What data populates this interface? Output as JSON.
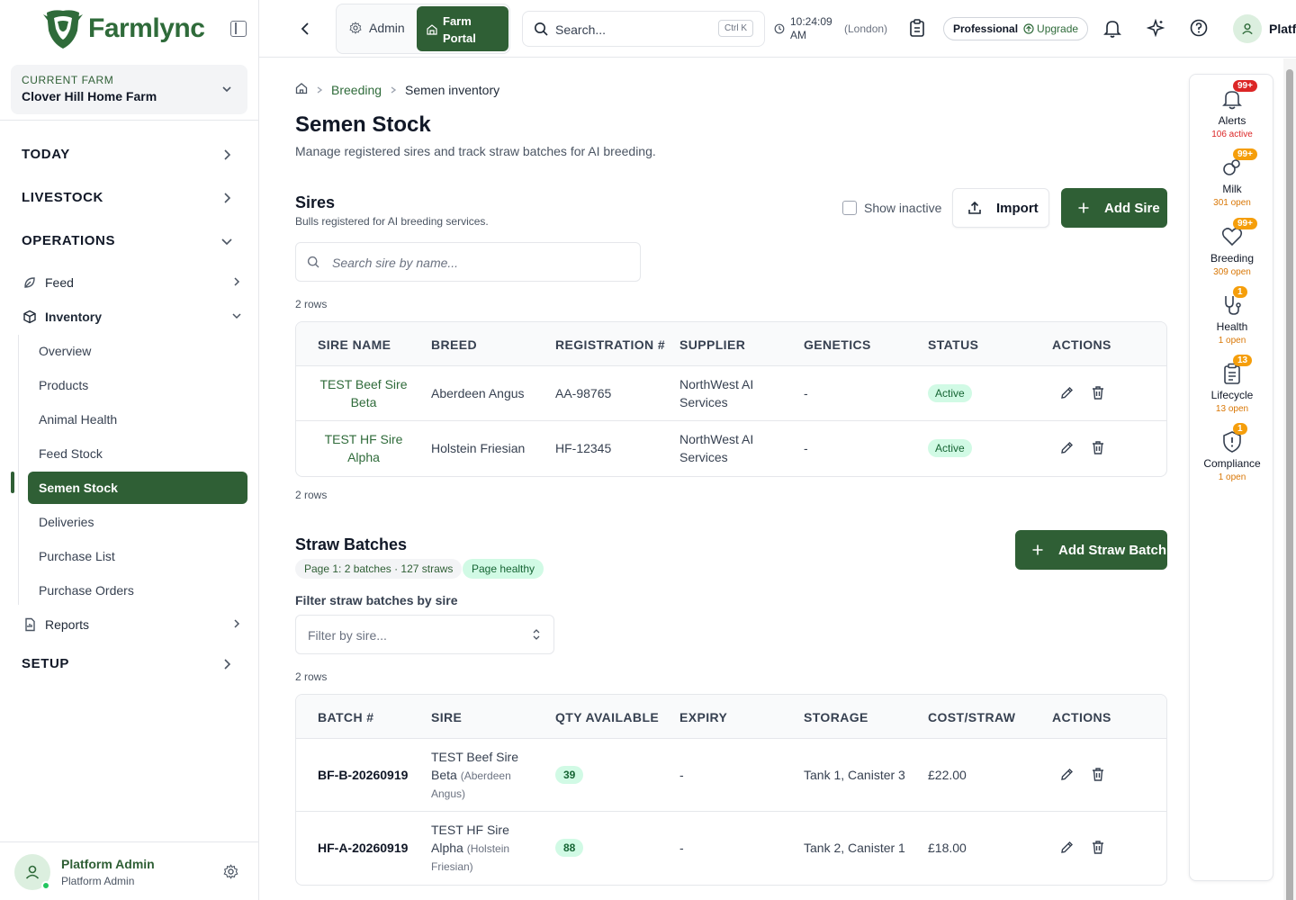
{
  "app": {
    "name": "Farmlync"
  },
  "farm": {
    "label": "CURRENT FARM",
    "name": "Clover Hill Home Farm"
  },
  "nav": {
    "today": "TODAY",
    "livestock": "LIVESTOCK",
    "operations": "OPERATIONS",
    "feed": "Feed",
    "inventory": "Inventory",
    "sub": [
      "Overview",
      "Products",
      "Animal Health",
      "Feed Stock",
      "Semen Stock",
      "Deliveries",
      "Purchase List",
      "Purchase Orders"
    ],
    "reports": "Reports",
    "setup": "SETUP"
  },
  "user": {
    "name": "Platform Admin",
    "role": "Platform Admin",
    "top_name": "Platf"
  },
  "topbar": {
    "admin": "Admin",
    "farm_portal_1": "Farm",
    "farm_portal_2": "Portal",
    "search_placeholder": "Search...",
    "shortcut": "Ctrl K",
    "time_1": "10:24:09",
    "time_2": "AM",
    "timezone": "(London)",
    "plan": "Professional",
    "upgrade": "Upgrade"
  },
  "breadcrumb": {
    "parent": "Breeding",
    "current": "Semen inventory"
  },
  "page": {
    "title": "Semen Stock",
    "subtitle": "Manage registered sires and track straw batches for AI breeding."
  },
  "sires": {
    "title": "Sires",
    "subtitle": "Bulls registered for AI breeding services.",
    "show_inactive": "Show inactive",
    "import": "Import",
    "add": "Add Sire",
    "search_placeholder": "Search sire by name...",
    "rows_top": "2 rows",
    "rows_bottom": "2 rows",
    "columns": [
      "SIRE NAME",
      "BREED",
      "REGISTRATION #",
      "SUPPLIER",
      "GENETICS",
      "STATUS",
      "ACTIONS"
    ],
    "rows": [
      {
        "name_1": "TEST Beef Sire",
        "name_2": "Beta",
        "breed": "Aberdeen Angus",
        "reg": "AA-98765",
        "supplier_1": "NorthWest AI",
        "supplier_2": "Services",
        "genetics": "-",
        "status": "Active"
      },
      {
        "name_1": "TEST HF Sire",
        "name_2": "Alpha",
        "breed": "Holstein Friesian",
        "reg": "HF-12345",
        "supplier_1": "NorthWest AI",
        "supplier_2": "Services",
        "genetics": "-",
        "status": "Active"
      }
    ]
  },
  "straws": {
    "title": "Straw Batches",
    "page_summary": "Page 1: 2 batches · 127 straws",
    "health": "Page healthy",
    "add": "Add Straw Batch",
    "filter_label": "Filter straw batches by sire",
    "filter_placeholder": "Filter by sire...",
    "rows_top": "2 rows",
    "columns": [
      "BATCH #",
      "SIRE",
      "QTY AVAILABLE",
      "EXPIRY",
      "STORAGE",
      "COST/STRAW",
      "ACTIONS"
    ],
    "rows": [
      {
        "batch": "BF-B-20260919",
        "sire_1": "TEST Beef Sire",
        "sire_2": "Beta",
        "breed_1": "(Aberdeen",
        "breed_2": "Angus)",
        "qty": "39",
        "expiry": "-",
        "storage": "Tank 1, Canister 3",
        "cost": "£22.00"
      },
      {
        "batch": "HF-A-20260919",
        "sire_1": "TEST HF Sire",
        "sire_2": "Alpha",
        "breed_1": "(Holstein",
        "breed_2": "Friesian)",
        "qty": "88",
        "expiry": "-",
        "storage": "Tank 2, Canister 1",
        "cost": "£18.00"
      }
    ]
  },
  "rail": [
    {
      "label": "Alerts",
      "badge": "99+",
      "count": "106 active",
      "icon": "bell-icon",
      "badge_color": "#dc2626",
      "count_color": "#dc2626"
    },
    {
      "label": "Milk",
      "badge": "99+",
      "count": "301 open",
      "icon": "milk-drop-icon",
      "badge_color": "#f59e0b",
      "count_color": "#d97706"
    },
    {
      "label": "Breeding",
      "badge": "99+",
      "count": "309 open",
      "icon": "heart-icon",
      "badge_color": "#f59e0b",
      "count_color": "#d97706"
    },
    {
      "label": "Health",
      "badge": "1",
      "count": "1 open",
      "icon": "stethoscope-icon",
      "badge_color": "#f59e0b",
      "count_color": "#d97706"
    },
    {
      "label": "Lifecycle",
      "badge": "13",
      "count": "13 open",
      "icon": "clipboard-icon",
      "badge_color": "#f59e0b",
      "count_color": "#d97706"
    },
    {
      "label": "Compliance",
      "badge": "1",
      "count": "1 open",
      "icon": "shield-icon",
      "badge_color": "#f59e0b",
      "count_color": "#d97706"
    }
  ],
  "colors": {
    "brand": "#2f5f35",
    "active_badge_bg": "#d1fae5",
    "alert_red": "#dc2626",
    "warn_amber": "#f59e0b"
  }
}
